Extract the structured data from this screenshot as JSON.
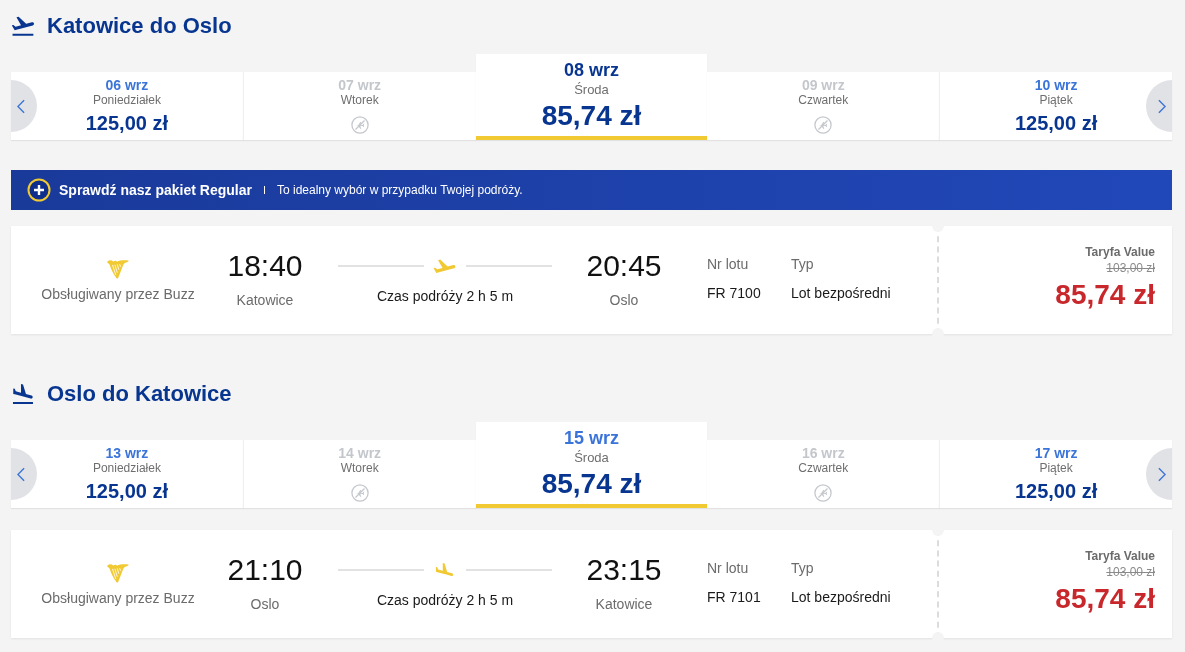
{
  "sections": [
    {
      "title": "Katowice do Oslo",
      "dates": [
        {
          "date": "06 wrz",
          "day": "Poniedziałek",
          "price": "125,00 zł",
          "available": true,
          "selected": false,
          "hovered": false
        },
        {
          "date": "07 wrz",
          "day": "Wtorek",
          "available": false,
          "selected": false,
          "hovered": false
        },
        {
          "date": "08 wrz",
          "day": "Środa",
          "price": "85,74 zł",
          "available": true,
          "selected": true,
          "hovered": false
        },
        {
          "date": "09 wrz",
          "day": "Czwartek",
          "available": false,
          "selected": false,
          "hovered": false
        },
        {
          "date": "10 wrz",
          "day": "Piątek",
          "price": "125,00 zł",
          "available": true,
          "selected": false,
          "hovered": false
        }
      ],
      "banner": {
        "title": "Sprawdź nasz pakiet Regular",
        "text": "To idealny wybór w przypadku Twojej podróży."
      },
      "flight": {
        "operator": "Obsługiwany przez Buzz",
        "departure": {
          "time": "18:40",
          "city": "Katowice"
        },
        "duration": "Czas podróży 2 h 5 m",
        "arrival": {
          "time": "20:45",
          "city": "Oslo"
        },
        "flight_number_label": "Nr lotu",
        "flight_number": "FR 7100",
        "type_label": "Typ",
        "type": "Lot bezpośredni",
        "fare_label": "Taryfa Value",
        "old_price": "103,00 zł",
        "price": "85,74 zł"
      }
    },
    {
      "title": "Oslo do Katowice",
      "dates": [
        {
          "date": "13 wrz",
          "day": "Poniedziałek",
          "price": "125,00 zł",
          "available": true,
          "selected": false,
          "hovered": false
        },
        {
          "date": "14 wrz",
          "day": "Wtorek",
          "available": false,
          "selected": false,
          "hovered": false
        },
        {
          "date": "15 wrz",
          "day": "Środa",
          "price": "85,74 zł",
          "available": true,
          "selected": true,
          "hovered": true
        },
        {
          "date": "16 wrz",
          "day": "Czwartek",
          "available": false,
          "selected": false,
          "hovered": false
        },
        {
          "date": "17 wrz",
          "day": "Piątek",
          "price": "125,00 zł",
          "available": true,
          "selected": false,
          "hovered": false
        }
      ],
      "flight": {
        "operator": "Obsługiwany przez Buzz",
        "departure": {
          "time": "21:10",
          "city": "Oslo"
        },
        "duration": "Czas podróży 2 h 5 m",
        "arrival": {
          "time": "23:15",
          "city": "Katowice"
        },
        "flight_number_label": "Nr lotu",
        "flight_number": "FR 7101",
        "type_label": "Typ",
        "type": "Lot bezpośredni",
        "fare_label": "Taryfa Value",
        "old_price": "103,00 zł",
        "price": "85,74 zł"
      }
    }
  ]
}
